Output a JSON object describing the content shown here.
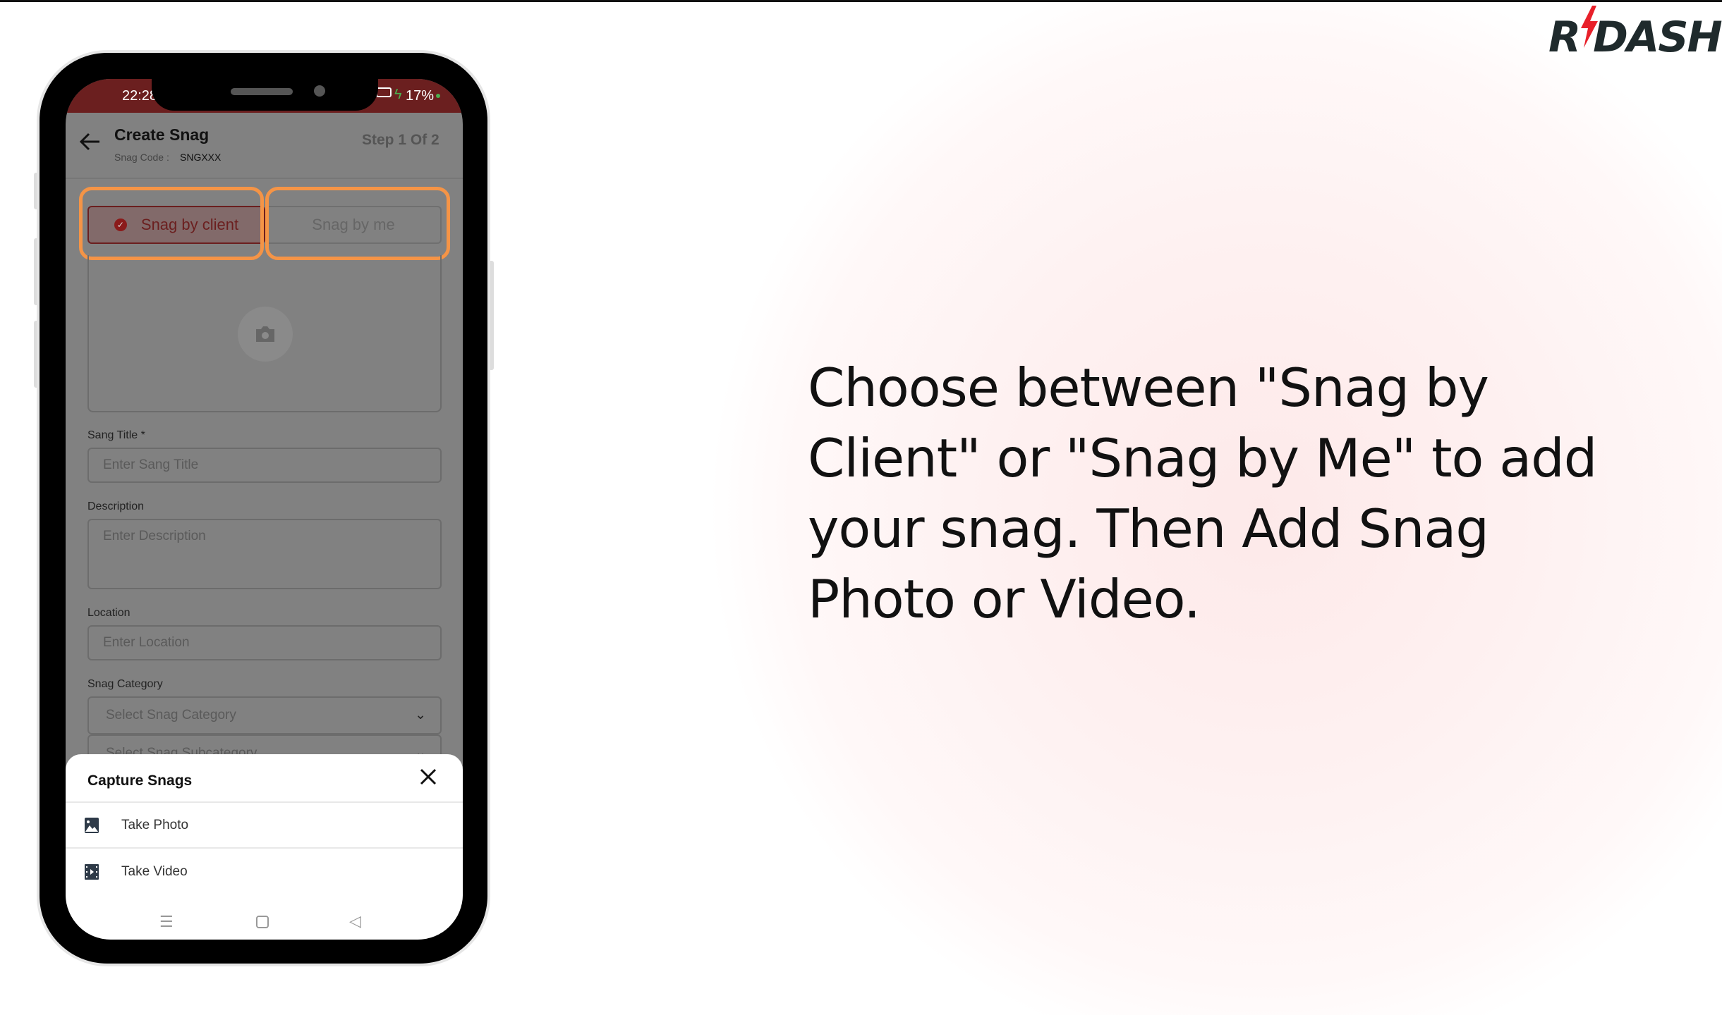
{
  "brand": {
    "logo_text": "R DASH",
    "accent": "#e8202a"
  },
  "caption": "Choose between \"Snag by Client\" or \"Snag by Me\" to add your snag. Then Add Snag Photo or Video.",
  "phone": {
    "status": {
      "time": "22:28",
      "battery": "17%"
    },
    "header": {
      "title": "Create Snag",
      "code_label": "Snag Code :",
      "code_value": "SNGXXX",
      "step": "Step 1 Of 2"
    },
    "toggle": {
      "client": "Snag by client",
      "me": "Snag by me",
      "selected": "client"
    },
    "form": {
      "title_label": "Sang Title *",
      "title_placeholder": "Enter Sang Title",
      "desc_label": "Description",
      "desc_placeholder": "Enter Description",
      "loc_label": "Location",
      "loc_placeholder": "Enter Location",
      "cat_label": "Snag Category",
      "cat_placeholder": "Select Snag Category",
      "subcat_placeholder": "Select Snag Subcategory"
    },
    "sheet": {
      "title": "Capture Snags",
      "items": [
        {
          "label": "Take Photo",
          "icon": "image-icon"
        },
        {
          "label": "Take Video",
          "icon": "film-icon"
        }
      ]
    }
  }
}
